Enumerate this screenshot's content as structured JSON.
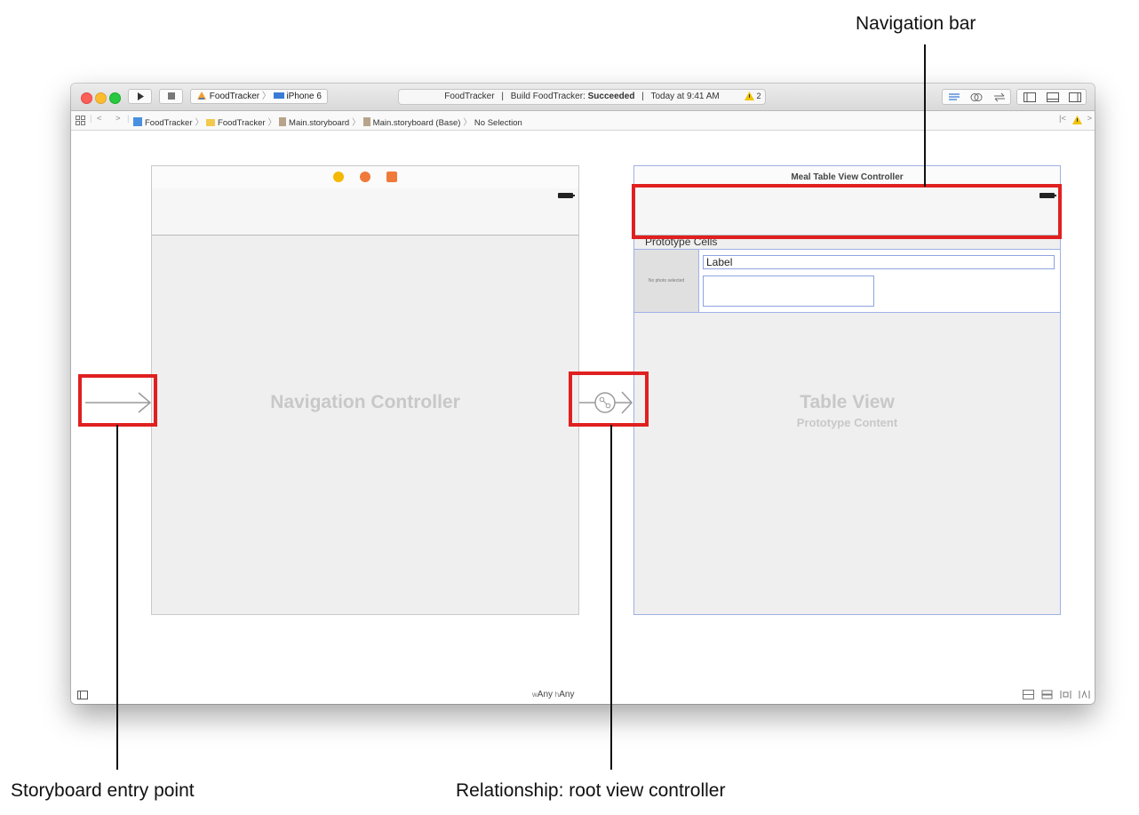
{
  "callouts": {
    "navigation_bar": "Navigation bar",
    "entry_point": "Storyboard entry point",
    "relationship": "Relationship: root view controller"
  },
  "toolbar": {
    "scheme_app": "FoodTracker",
    "scheme_device": "iPhone 6",
    "activity_project": "FoodTracker",
    "activity_build_prefix": "Build FoodTracker:",
    "activity_build_status": "Succeeded",
    "activity_time": "Today at 9:41 AM",
    "warning_count": "2",
    "play_icon": "play-icon",
    "stop_icon": "stop-icon"
  },
  "jumpbar": {
    "crumbs": [
      "FoodTracker",
      "FoodTracker",
      "Main.storyboard",
      "Main.storyboard (Base)",
      "No Selection"
    ]
  },
  "canvas": {
    "nav_controller_label": "Navigation Controller",
    "table_scene_title": "Meal Table View Controller",
    "prototype_cells_label": "Prototype Cells",
    "photo_placeholder": "No photo selected",
    "cell_label": "Label",
    "table_view_label": "Table View",
    "table_view_sublabel": "Prototype Content"
  },
  "bottombar": {
    "size_class_w": "w",
    "size_class_w_value": "Any",
    "size_class_h": "h",
    "size_class_h_value": "Any"
  },
  "colors": {
    "highlight": "#e02020",
    "selection_border": "#9fb1e6"
  }
}
